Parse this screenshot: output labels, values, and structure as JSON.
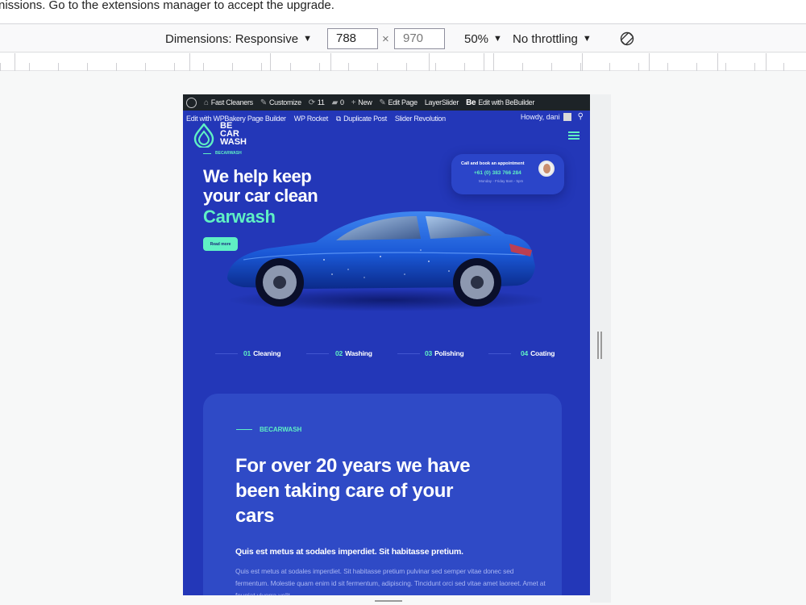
{
  "notice": {
    "text": "nissions. Go to the extensions manager to accept the upgrade."
  },
  "toolbar": {
    "dimensions_label": "Dimensions: Responsive",
    "width_value": "788",
    "times": "×",
    "height_value": "970",
    "zoom": "50%",
    "throttling": "No throttling",
    "rotate_icon": "rotate-icon"
  },
  "wp_admin_bar": {
    "row1": [
      "Fast Cleaners",
      "Customize",
      "11",
      "0",
      "New",
      "Edit Page",
      "LayerSlider",
      "Edit with BeBuilder"
    ],
    "be_badge": "Be",
    "row2": [
      "Edit with WPBakery Page Builder",
      "WP Rocket",
      "Duplicate Post",
      "Slider Revolution"
    ],
    "howdy": "Howdy, dani"
  },
  "site": {
    "logo_lines": [
      "BE",
      "CAR",
      "WASH"
    ],
    "mini_label": "BECARWASH",
    "hero_line1": "We help keep",
    "hero_line2": "your car clean",
    "hero_accent": "Carwash",
    "read_more": "Read more",
    "appointment": {
      "label": "Call and book an appointment",
      "phone": "+61 (0) 383 766 284",
      "hours": "Monday - Friday 8am - 5pm"
    },
    "steps": [
      {
        "num": "01",
        "label": "Cleaning"
      },
      {
        "num": "02",
        "label": "Washing"
      },
      {
        "num": "03",
        "label": "Polishing"
      },
      {
        "num": "04",
        "label": "Coating"
      }
    ],
    "about": {
      "eyebrow": "BECARWASH",
      "title": "For over 20 years we have been taking care of your cars",
      "subtitle": "Quis est metus at sodales imperdiet. Sit habitasse pretium.",
      "body": "Quis est metus at sodales imperdiet. Sit habitasse pretium pulvinar sed semper vitae donec sed fermentum. Molestie quam enim id sit fermentum, adipiscing. Tincidunt orci sed vitae amet laoreet. Amet at feugiat viverra velit."
    }
  },
  "colors": {
    "site_bg": "#2337b8",
    "accent": "#5ff0c4",
    "card_bg": "#2f4ac6",
    "admin_bar": "#1d2327"
  }
}
